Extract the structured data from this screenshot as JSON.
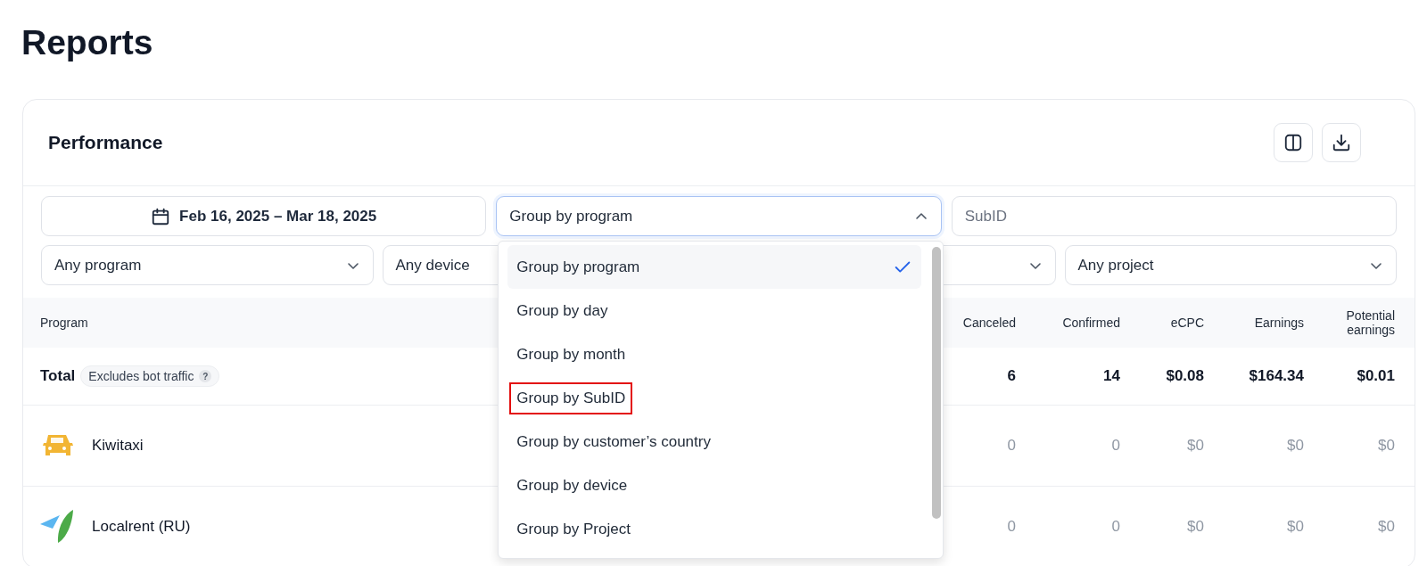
{
  "page": {
    "title": "Reports"
  },
  "card": {
    "title": "Performance"
  },
  "filters": {
    "date_range": "Feb 16, 2025 – Mar 18, 2025",
    "group_by": {
      "value": "Group by program",
      "expanded": true,
      "options": [
        {
          "label": "Group by program",
          "selected": true,
          "highlighted": false
        },
        {
          "label": "Group by day",
          "selected": false,
          "highlighted": false
        },
        {
          "label": "Group by month",
          "selected": false,
          "highlighted": false
        },
        {
          "label": "Group by SubID",
          "selected": false,
          "highlighted": true
        },
        {
          "label": "Group by customer’s country",
          "selected": false,
          "highlighted": false
        },
        {
          "label": "Group by device",
          "selected": false,
          "highlighted": false
        },
        {
          "label": "Group by Project",
          "selected": false,
          "highlighted": false
        }
      ]
    },
    "subid": {
      "placeholder": "SubID"
    },
    "selects": [
      {
        "label": "Any program"
      },
      {
        "label": "Any device"
      },
      {
        "covered": true
      },
      {
        "label": "Any project"
      }
    ]
  },
  "table": {
    "program_header": "Program",
    "columns": [
      "Canceled",
      "Confirmed",
      "eCPC",
      "Earnings",
      "Potential earnings"
    ],
    "rows": [
      {
        "kind": "total",
        "name": "Total",
        "badge": "Excludes bot traffic",
        "help": "?",
        "cells": [
          "6",
          "14",
          "$0.08",
          "$164.34",
          "$0.01"
        ]
      },
      {
        "kind": "car",
        "name": "Kiwitaxi",
        "cells": [
          "0",
          "0",
          "$0",
          "$0",
          "$0"
        ]
      },
      {
        "kind": "plane",
        "name": "Localrent (RU)",
        "cells": [
          "0",
          "0",
          "$0",
          "$0",
          "$0"
        ]
      }
    ]
  }
}
